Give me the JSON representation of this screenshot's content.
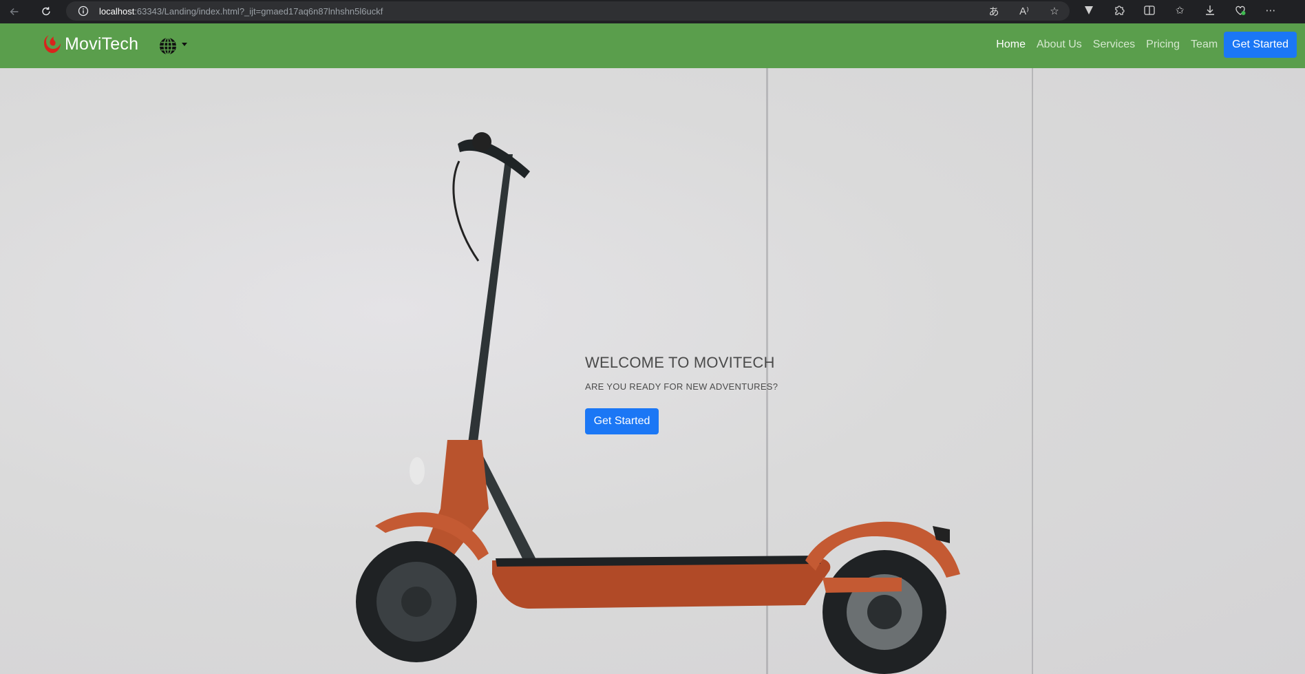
{
  "browser": {
    "url_host": "localhost",
    "url_rest": ":63343/Landing/index.html?_ijt=gmaed17aq6n87lnhshn5l6uckf"
  },
  "navbar": {
    "brand": "MoviTech",
    "links": [
      {
        "label": "Home",
        "active": true
      },
      {
        "label": "About Us",
        "active": false
      },
      {
        "label": "Services",
        "active": false
      },
      {
        "label": "Pricing",
        "active": false
      },
      {
        "label": "Team",
        "active": false
      }
    ],
    "cta": "Get Started",
    "colors": {
      "background": "#5a9e4c",
      "cta": "#1b77f5"
    }
  },
  "hero": {
    "title": "WELCOME TO MOVITECH",
    "subtitle": "ARE YOU READY FOR NEW ADVENTURES?",
    "cta": "Get Started"
  },
  "icons": {
    "browser": [
      "back-arrow-icon",
      "reload-icon",
      "info-icon",
      "read-aloud-icon",
      "translate-icon",
      "favorite-star-icon",
      "extension-v-icon",
      "extensions-puzzle-icon",
      "split-screen-icon",
      "favorites-icon",
      "download-icon",
      "browser-essentials-icon",
      "more-icon"
    ],
    "page": [
      "brand-logo-icon",
      "globe-icon",
      "caret-down-icon"
    ]
  }
}
